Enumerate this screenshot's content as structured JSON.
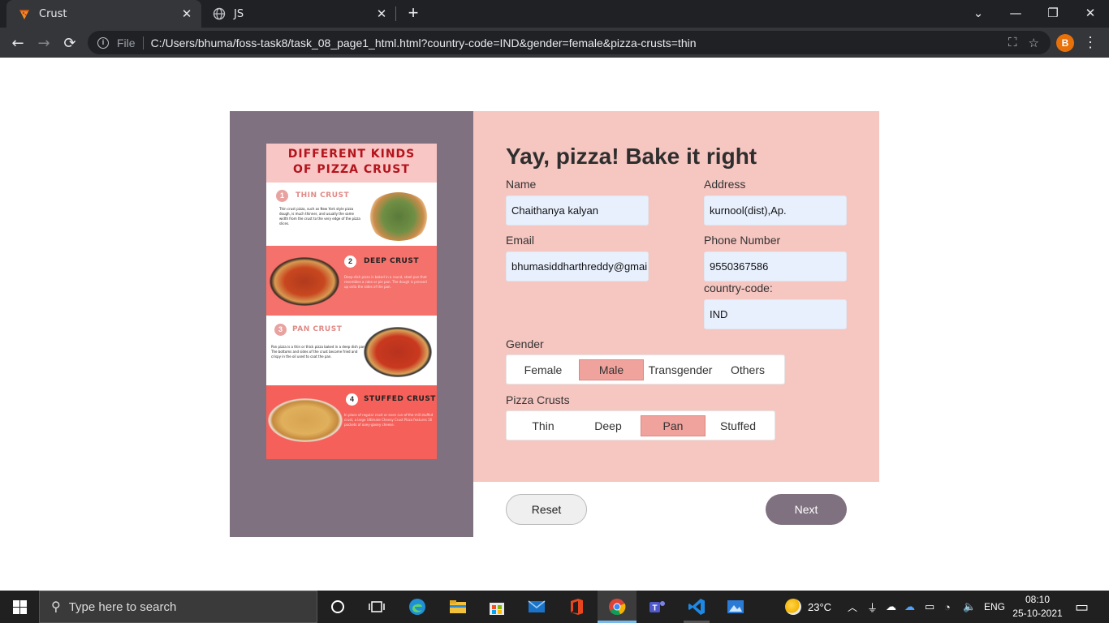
{
  "browser": {
    "tabs": [
      {
        "title": "Crust",
        "active": true
      },
      {
        "title": "JS",
        "active": false
      }
    ],
    "new_tab": "+",
    "address_prefix": "File",
    "url": "C:/Users/bhuma/foss-task8/task_08_page1_html.html?country-code=IND&gender=female&pizza-crusts=thin",
    "profile_initial": "B"
  },
  "infographic": {
    "title_line1": "DIFFERENT KINDS",
    "title_line2": "OF PIZZA CRUST",
    "sections": [
      {
        "num": "1",
        "title": "THIN CRUST",
        "text": "Thin crust pizza, such as New York style pizza dough, is much thinner, and usually the same width from the crust to the very edge of the pizza slices."
      },
      {
        "num": "2",
        "title": "DEEP CRUST",
        "text": "Deep-dish pizza is baked in a round, steel pan that resembles a cake or pie pan. The dough is pressed up onto the sides of the pan."
      },
      {
        "num": "3",
        "title": "PAN CRUST",
        "text": "Pan pizza is a thin or thick pizza baked in a deep dish pan. The bottoms and sides of the crust become fried and crispy in the oil used to coat the pan."
      },
      {
        "num": "4",
        "title": "STUFFED CRUST",
        "text": "In place of regular crust or even run-of-the-mill stuffed crust, a large Ultimate Cheesy Crust Pizza features 16 pockets of ooey-gooey cheese."
      }
    ]
  },
  "form": {
    "title": "Yay, pizza! Bake it right",
    "name_label": "Name",
    "name_value": "Chaithanya kalyan",
    "address_label": "Address",
    "address_value": "kurnool(dist),Ap.",
    "email_label": "Email",
    "email_value": "bhumasiddharthreddy@gmail.com",
    "phone_label": "Phone Number",
    "phone_value": "9550367586",
    "country_label": "country-code:",
    "country_value": "IND",
    "gender_label": "Gender",
    "gender_options": [
      "Female",
      "Male",
      "Transgender",
      "Others"
    ],
    "gender_selected": "Male",
    "crust_label": "Pizza Crusts",
    "crust_options": [
      "Thin",
      "Deep",
      "Pan",
      "Stuffed"
    ],
    "crust_selected": "Pan",
    "reset_label": "Reset",
    "next_label": "Next"
  },
  "taskbar": {
    "search_placeholder": "Type here to search",
    "weather": "23°C",
    "language": "ENG",
    "time": "08:10",
    "date": "25-10-2021"
  },
  "colors": {
    "left_panel": "#807180",
    "form_panel": "#f6c6c1",
    "selected_option": "#f0a29d",
    "input_bg": "#e8f0fe"
  }
}
